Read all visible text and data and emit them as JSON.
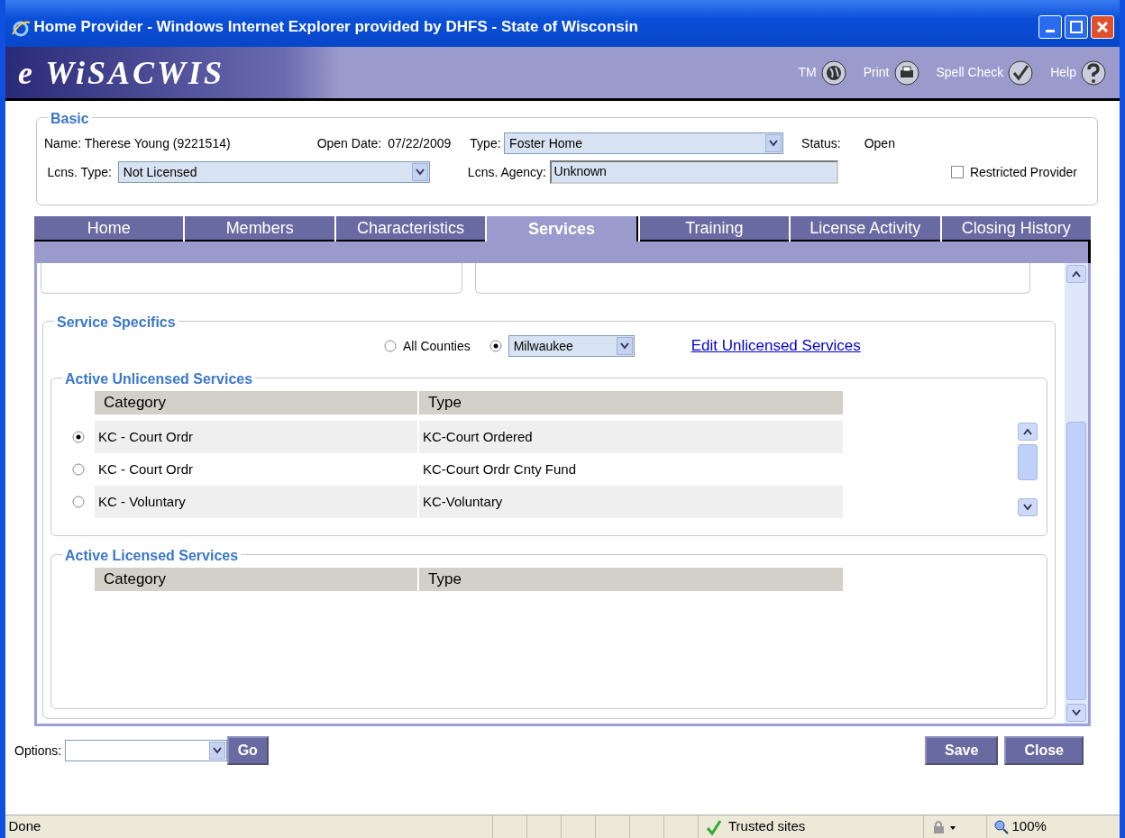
{
  "window": {
    "title": "Home Provider - Windows Internet Explorer provided by DHFS - State of Wisconsin"
  },
  "header": {
    "logo": "e WiSACWIS",
    "tools": [
      {
        "label": "TM",
        "kind": "globe"
      },
      {
        "label": "Print",
        "kind": "print"
      },
      {
        "label": "Spell Check",
        "kind": "spell"
      },
      {
        "label": "Help",
        "kind": "help"
      }
    ]
  },
  "basic": {
    "legend": "Basic",
    "name_label": "Name:",
    "name": "Therese Young (9221514)",
    "open_date_label": "Open Date:",
    "open_date": "07/22/2009",
    "type_label": "Type:",
    "type": "Foster Home",
    "status_label": "Status:",
    "status": "Open",
    "lcns_type_label": "Lcns. Type:",
    "lcns_type": "Not Licensed",
    "lcns_agency_label": "Lcns. Agency:",
    "lcns_agency": "Unknown",
    "restricted": {
      "label": "Restricted Provider",
      "checked": false
    }
  },
  "tabs": [
    {
      "label": "Home",
      "selected": false
    },
    {
      "label": "Members",
      "selected": false
    },
    {
      "label": "Characteristics",
      "selected": false
    },
    {
      "label": "Services",
      "selected": true
    },
    {
      "label": "Training",
      "selected": false
    },
    {
      "label": "License Activity",
      "selected": false
    },
    {
      "label": "Closing History",
      "selected": false
    }
  ],
  "service_specifics": {
    "legend": "Service Specifics",
    "scope": [
      {
        "label": "All Counties",
        "selected": false,
        "kind": "label"
      },
      {
        "label": "Milwaukee",
        "selected": true,
        "kind": "select"
      }
    ],
    "edit_link": "Edit Unlicensed Services",
    "unlicensed": {
      "legend": "Active Unlicensed Services",
      "columns": [
        "Category",
        "Type"
      ],
      "rows": [
        {
          "category": "KC - Court Ordr",
          "type": "KC-Court Ordered",
          "selected": true
        },
        {
          "category": "KC - Court Ordr",
          "type": "KC-Court Ordr Cnty Fund",
          "selected": false
        },
        {
          "category": "KC - Voluntary",
          "type": "KC-Voluntary",
          "selected": false
        }
      ]
    },
    "licensed": {
      "legend": "Active Licensed Services",
      "columns": [
        "Category",
        "Type"
      ]
    }
  },
  "footer": {
    "options_label": "Options:",
    "go": "Go",
    "buttons": [
      "Save",
      "Close"
    ]
  },
  "status_bar": {
    "text": "Done",
    "zone": "Trusted sites",
    "zoom": "100%"
  }
}
